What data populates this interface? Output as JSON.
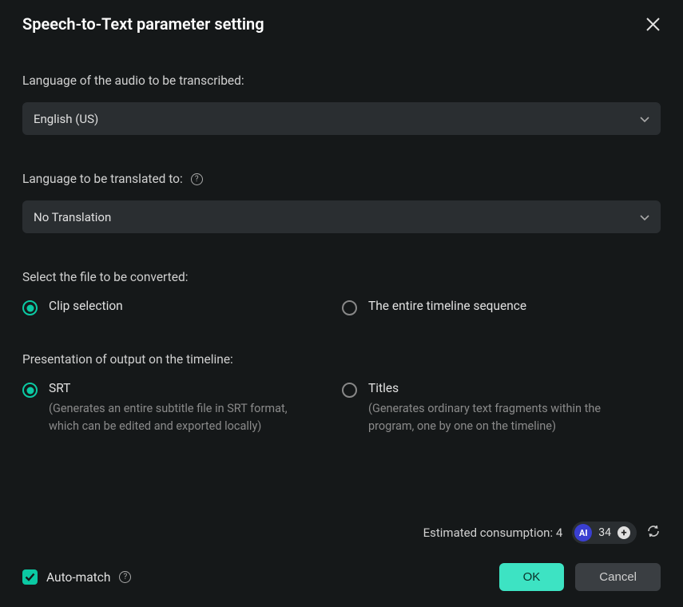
{
  "title": "Speech-to-Text parameter setting",
  "language_section": {
    "label": "Language of the audio to be transcribed:",
    "value": "English (US)"
  },
  "translate_section": {
    "label": "Language to be translated to:",
    "value": "No Translation"
  },
  "file_section": {
    "label": "Select the file to be converted:",
    "options": {
      "clip": "Clip selection",
      "timeline": "The entire timeline sequence"
    }
  },
  "output_section": {
    "label": "Presentation of output on the timeline:",
    "srt": {
      "label": "SRT",
      "desc": "(Generates an entire subtitle file in SRT format, which can be edited and exported locally)"
    },
    "titles": {
      "label": "Titles",
      "desc": "(Generates ordinary text fragments within the program, one by one on the timeline)"
    }
  },
  "footer": {
    "estimated_label": "Estimated consumption:",
    "estimated_value": "4",
    "ai_badge": "AI",
    "credits": "34",
    "automatch": "Auto-match",
    "ok": "OK",
    "cancel": "Cancel"
  }
}
